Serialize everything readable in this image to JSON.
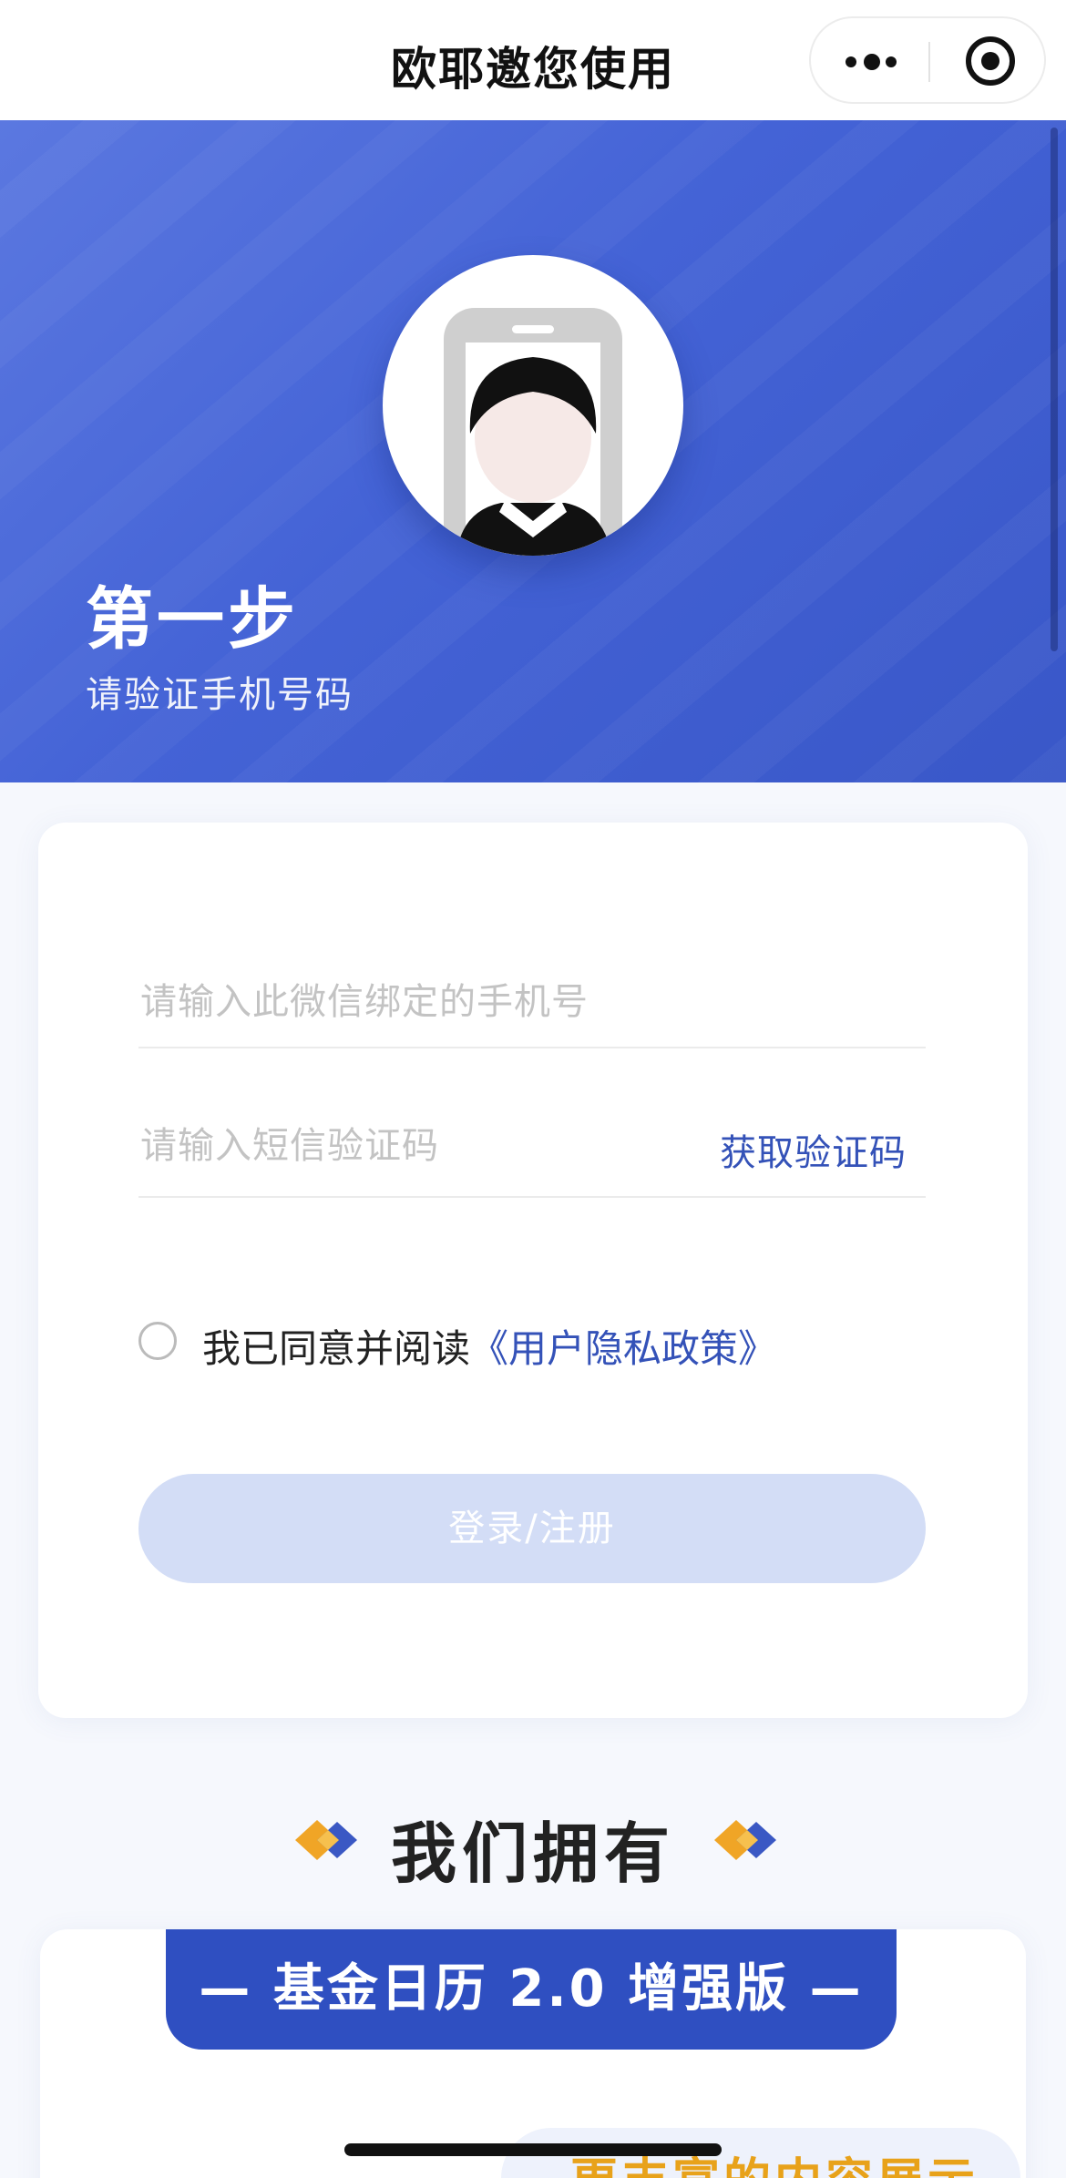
{
  "navbar": {
    "title": "欧耶邀您使用",
    "more_icon": "more-dots-icon",
    "close_icon": "target-circle-icon"
  },
  "hero": {
    "step_title": "第一步",
    "step_subtitle": "请验证手机号码",
    "avatar_icon": "phone-user-avatar-icon"
  },
  "form": {
    "phone_placeholder": "请输入此微信绑定的手机号",
    "code_placeholder": "请输入短信验证码",
    "get_code_label": "获取验证码",
    "agree_text": "我已同意并阅读",
    "policy_link": "《用户隐私政策》",
    "login_label": "登录/注册"
  },
  "section": {
    "title": "我们拥有",
    "icon": "diamond-icon"
  },
  "feature": {
    "ribbon_label": "— 基金日历 2.0 增强版 —",
    "promo_text": "更丰富的内容展示"
  },
  "colors": {
    "primary": "#3452b8",
    "hero_blue": "#4463d6",
    "button_disabled": "#d3ddf6",
    "accent_orange": "#f0a526"
  }
}
